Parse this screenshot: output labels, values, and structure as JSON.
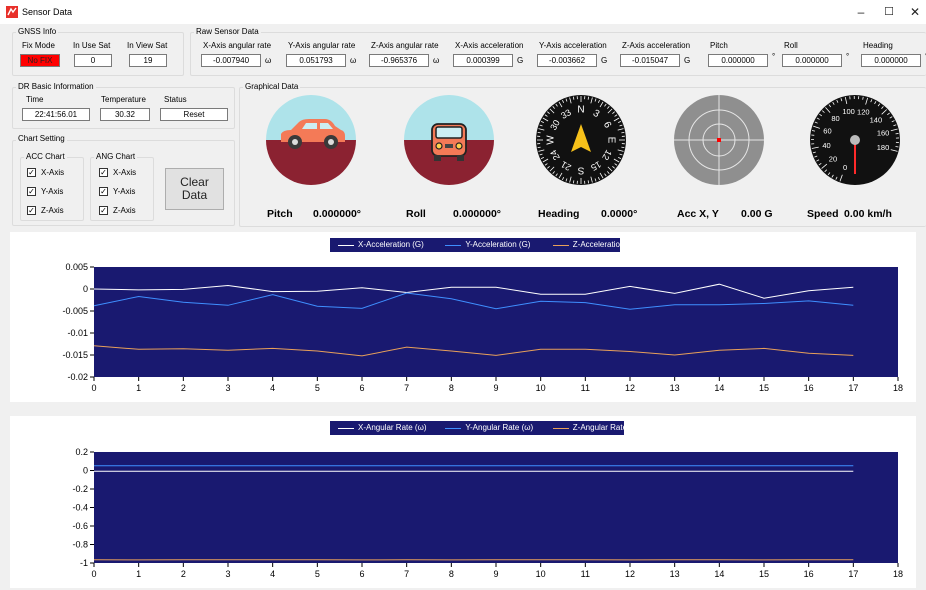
{
  "window": {
    "title": "Sensor Data",
    "minimize": "–",
    "maximize": "☐",
    "close": "✕",
    "icon": "app-icon",
    "icon_color": "#e8302a"
  },
  "gnss": {
    "title": "GNSS Info",
    "fix_mode_label": "Fix Mode",
    "fix_mode_value": "No FIX",
    "fix_mode_color": "#ff0000",
    "in_use_sat_label": "In Use Sat",
    "in_use_sat_value": "0",
    "in_view_sat_label": "In View Sat",
    "in_view_sat_value": "19"
  },
  "raw": {
    "title": "Raw Sensor Data",
    "fields": [
      {
        "label": "X-Axis angular rate",
        "value": "-0.007940",
        "unit": "ω"
      },
      {
        "label": "Y-Axis angular rate",
        "value": "0.051793",
        "unit": "ω"
      },
      {
        "label": "Z-Axis angular rate",
        "value": "-0.965376",
        "unit": "ω"
      },
      {
        "label": "X-Axis acceleration",
        "value": "0.000399",
        "unit": "G"
      },
      {
        "label": "Y-Axis acceleration",
        "value": "-0.003662",
        "unit": "G"
      },
      {
        "label": "Z-Axis acceleration",
        "value": "-0.015047",
        "unit": "G"
      },
      {
        "label": "Pitch",
        "value": "0.000000",
        "unit": "°"
      },
      {
        "label": "Roll",
        "value": "0.000000",
        "unit": "°"
      },
      {
        "label": "Heading",
        "value": "0.000000",
        "unit": "°"
      }
    ]
  },
  "dr": {
    "title": "DR Basic Information",
    "time_label": "Time",
    "time_value": "22:41:56.01",
    "temp_label": "Temperature",
    "temp_value": "30.32",
    "status_label": "Status",
    "status_value": "Reset"
  },
  "chart_setting": {
    "title": "Chart Setting",
    "acc_title": "ACC Chart",
    "ang_title": "ANG Chart",
    "acc_items": [
      {
        "label": "X-Axis",
        "checked": "✓"
      },
      {
        "label": "Y-Axis",
        "checked": "✓"
      },
      {
        "label": "Z-Axis",
        "checked": "✓"
      }
    ],
    "ang_items": [
      {
        "label": "X-Axis",
        "checked": "✓"
      },
      {
        "label": "Y-Axis",
        "checked": "✓"
      },
      {
        "label": "Z-Axis",
        "checked": "✓"
      }
    ],
    "clear_line1": "Clear",
    "clear_line2": "Data"
  },
  "graphical": {
    "title": "Graphical Data",
    "pitch_label": "Pitch",
    "pitch_value": "0.000000°",
    "roll_label": "Roll",
    "roll_value": "0.000000°",
    "heading_label": "Heading",
    "heading_value": "0.0000°",
    "acc_label": "Acc X, Y",
    "acc_value": "0.00 G",
    "speed_label": "Speed",
    "speed_value": "0.00 km/h",
    "compass_marks": [
      "N",
      "3",
      "6",
      "E",
      "12",
      "15",
      "S",
      "21",
      "24",
      "W",
      "30",
      "33"
    ],
    "speed_ticks": [
      "0",
      "20",
      "40",
      "60",
      "80",
      "100",
      "120",
      "140",
      "160",
      "180"
    ],
    "sky_color": "#aee3ea",
    "ground_color": "#8b2231",
    "car_color": "#f47a57",
    "needle_color": "#f7c11a"
  },
  "chart_data": [
    {
      "type": "line",
      "ylim": [
        -0.02,
        0.005
      ],
      "xlim": [
        0,
        18
      ],
      "yticks": [
        "0.005",
        "0",
        "-0.005",
        "-0.01",
        "-0.015",
        "-0.02"
      ],
      "ytick_values": [
        0.005,
        0,
        -0.005,
        -0.01,
        -0.015,
        -0.02
      ],
      "xticks": [
        "0",
        "1",
        "2",
        "3",
        "4",
        "5",
        "6",
        "7",
        "8",
        "9",
        "10",
        "11",
        "12",
        "13",
        "14",
        "15",
        "16",
        "17",
        "18"
      ],
      "x": [
        0,
        1,
        2,
        3,
        4,
        5,
        6,
        7,
        8,
        9,
        10,
        11,
        12,
        13,
        14,
        15,
        16,
        17
      ],
      "series": [
        {
          "name": "X-Acceleration (G)",
          "color": "#ffffff",
          "values": [
            0.0,
            -0.0002,
            -0.0001,
            0.0008,
            -0.0006,
            -0.0005,
            0.0003,
            -0.0008,
            0.0004,
            0.0004,
            -0.0012,
            -0.0012,
            0.0006,
            -0.001,
            0.0011,
            -0.0021,
            -0.0004,
            0.0004
          ]
        },
        {
          "name": "Y-Acceleration (G)",
          "color": "#3f8fff",
          "values": [
            -0.0038,
            -0.0017,
            -0.003,
            -0.0037,
            -0.0013,
            -0.0039,
            -0.0044,
            -0.0009,
            -0.0022,
            -0.0045,
            -0.0028,
            -0.0031,
            -0.0046,
            -0.0036,
            -0.0036,
            -0.0033,
            -0.0027,
            -0.0037
          ]
        },
        {
          "name": "Z-Acceleration (G)",
          "color": "#e8a05a",
          "values": [
            -0.0129,
            -0.0137,
            -0.0136,
            -0.0139,
            -0.0135,
            -0.0141,
            -0.0152,
            -0.0132,
            -0.0141,
            -0.0151,
            -0.0137,
            -0.0137,
            -0.0142,
            -0.015,
            -0.0139,
            -0.0135,
            -0.0146,
            -0.0151
          ]
        }
      ]
    },
    {
      "type": "line",
      "ylim": [
        -1.0,
        0.2
      ],
      "xlim": [
        0,
        18
      ],
      "yticks": [
        "0.2",
        "0",
        "-0.2",
        "-0.4",
        "-0.6",
        "-0.8",
        "-1"
      ],
      "ytick_values": [
        0.2,
        0,
        -0.2,
        -0.4,
        -0.6,
        -0.8,
        -1.0
      ],
      "xticks": [
        "0",
        "1",
        "2",
        "3",
        "4",
        "5",
        "6",
        "7",
        "8",
        "9",
        "10",
        "11",
        "12",
        "13",
        "14",
        "15",
        "16",
        "17",
        "18"
      ],
      "x": [
        0,
        1,
        2,
        3,
        4,
        5,
        6,
        7,
        8,
        9,
        10,
        11,
        12,
        13,
        14,
        15,
        16,
        17
      ],
      "series": [
        {
          "name": "X-Angular Rate (ω)",
          "color": "#ffffff",
          "values": [
            -0.008,
            -0.008,
            -0.008,
            -0.008,
            -0.008,
            -0.008,
            -0.008,
            -0.008,
            -0.008,
            -0.008,
            -0.008,
            -0.008,
            -0.008,
            -0.008,
            -0.008,
            -0.008,
            -0.008,
            -0.008
          ]
        },
        {
          "name": "Y-Angular Rate (ω)",
          "color": "#3f8fff",
          "values": [
            0.052,
            0.052,
            0.052,
            0.052,
            0.052,
            0.052,
            0.052,
            0.052,
            0.052,
            0.052,
            0.052,
            0.052,
            0.052,
            0.052,
            0.052,
            0.052,
            0.052,
            0.052
          ]
        },
        {
          "name": "Z-Angular Rate (ω)",
          "color": "#e8a05a",
          "values": [
            -0.965,
            -0.966,
            -0.965,
            -0.965,
            -0.965,
            -0.965,
            -0.966,
            -0.965,
            -0.966,
            -0.965,
            -0.965,
            -0.965,
            -0.966,
            -0.965,
            -0.965,
            -0.966,
            -0.965,
            -0.965
          ]
        }
      ]
    }
  ]
}
